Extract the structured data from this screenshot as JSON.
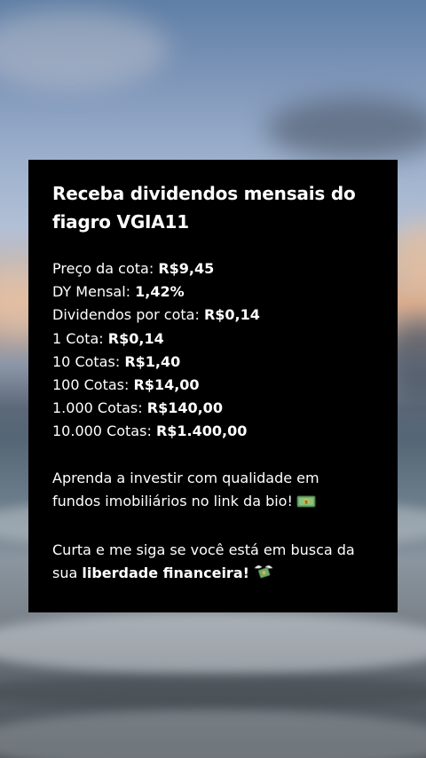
{
  "card": {
    "title": "Receba dividendos mensais do fiagro VGIA11",
    "stats": [
      {
        "label": "Preço da cota:",
        "value": "R$9,45"
      },
      {
        "label": "DY Mensal:",
        "value": "1,42%"
      },
      {
        "label": "Dividendos por cota:",
        "value": "R$0,14"
      },
      {
        "label": "1 Cota:",
        "value": "R$0,14"
      },
      {
        "label": "10 Cotas:",
        "value": "R$1,40"
      },
      {
        "label": "100 Cotas:",
        "value": "R$14,00"
      },
      {
        "label": "1.000 Cotas:",
        "value": "R$140,00"
      },
      {
        "label": "10.000 Cotas:",
        "value": "R$1.400,00"
      }
    ],
    "cta1": {
      "line1": "Aprenda a investir com qualidade em",
      "line2": "fundos imobiliários no link da bio!",
      "icon": "money-bill-icon"
    },
    "cta2": {
      "line1": "Curta e me siga se você está em busca da",
      "line2_prefix": "sua",
      "line2_bold": "liberdade financeira!",
      "icon": "money-with-wings-icon"
    }
  },
  "colors": {
    "card_bg": "#000000",
    "text": "#ffffff",
    "money_green": "#6fa86a"
  }
}
